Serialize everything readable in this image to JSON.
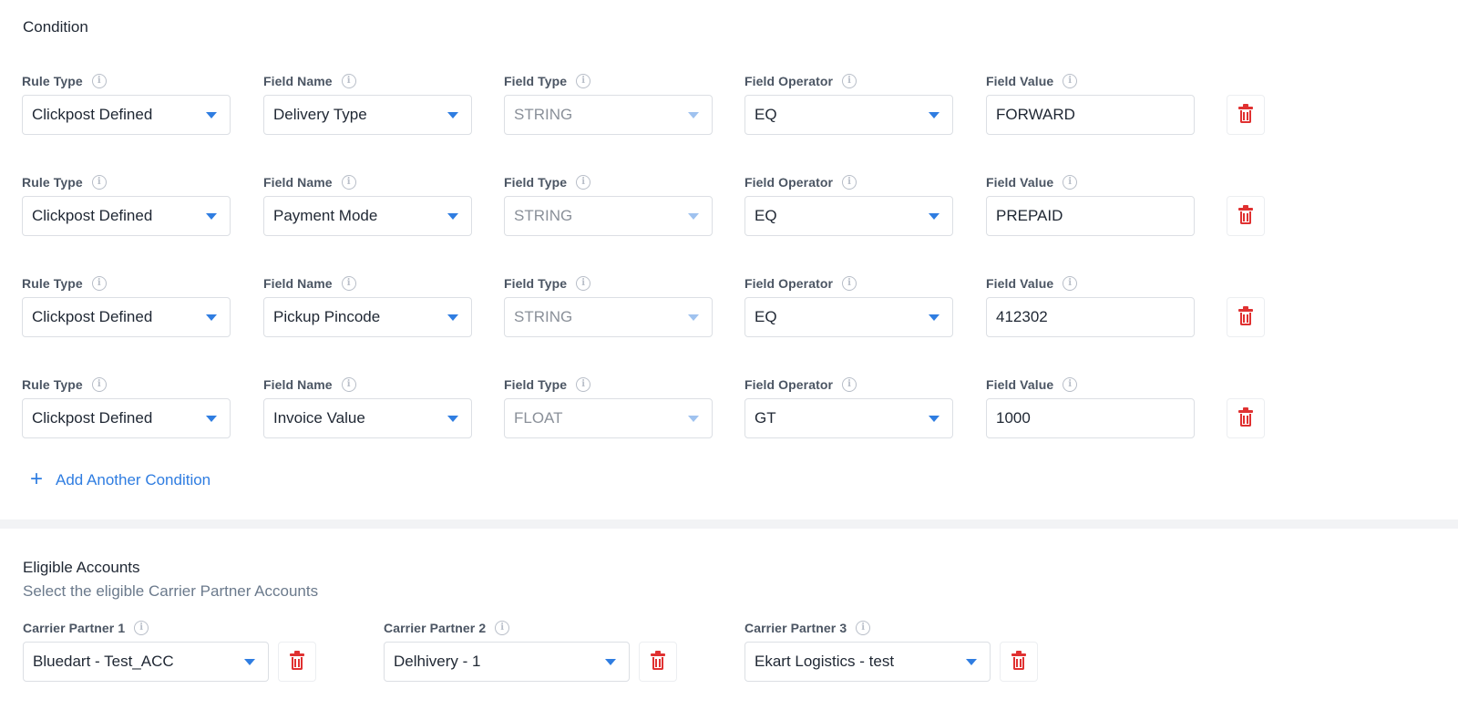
{
  "condition": {
    "title": "Condition",
    "labels": {
      "rule_type": "Rule Type",
      "field_name": "Field Name",
      "field_type": "Field Type",
      "field_operator": "Field Operator",
      "field_value": "Field Value"
    },
    "rows": [
      {
        "rule_type": "Clickpost Defined",
        "field_name": "Delivery Type",
        "field_type": "STRING",
        "field_operator": "EQ",
        "field_value": "FORWARD"
      },
      {
        "rule_type": "Clickpost Defined",
        "field_name": "Payment Mode",
        "field_type": "STRING",
        "field_operator": "EQ",
        "field_value": "PREPAID"
      },
      {
        "rule_type": "Clickpost Defined",
        "field_name": "Pickup Pincode",
        "field_type": "STRING",
        "field_operator": "EQ",
        "field_value": "412302"
      },
      {
        "rule_type": "Clickpost Defined",
        "field_name": "Invoice Value",
        "field_type": "FLOAT",
        "field_operator": "GT",
        "field_value": "1000"
      }
    ],
    "add_label": "Add Another Condition"
  },
  "eligible": {
    "title": "Eligible Accounts",
    "subtitle": "Select the eligible Carrier Partner Accounts",
    "partners": [
      {
        "label": "Carrier Partner 1",
        "value": "Bluedart - Test_ACC"
      },
      {
        "label": "Carrier Partner 2",
        "value": "Delhivery - 1"
      },
      {
        "label": "Carrier Partner 3",
        "value": "Ekart Logistics - test"
      }
    ]
  },
  "colors": {
    "accent": "#2f7de1",
    "danger": "#e03131",
    "label": "#4b5563",
    "muted": "#6b7a8c"
  },
  "icons": {
    "info": "info-icon",
    "caret": "chevron-down-icon",
    "delete": "trash-icon",
    "add": "plus-icon"
  }
}
